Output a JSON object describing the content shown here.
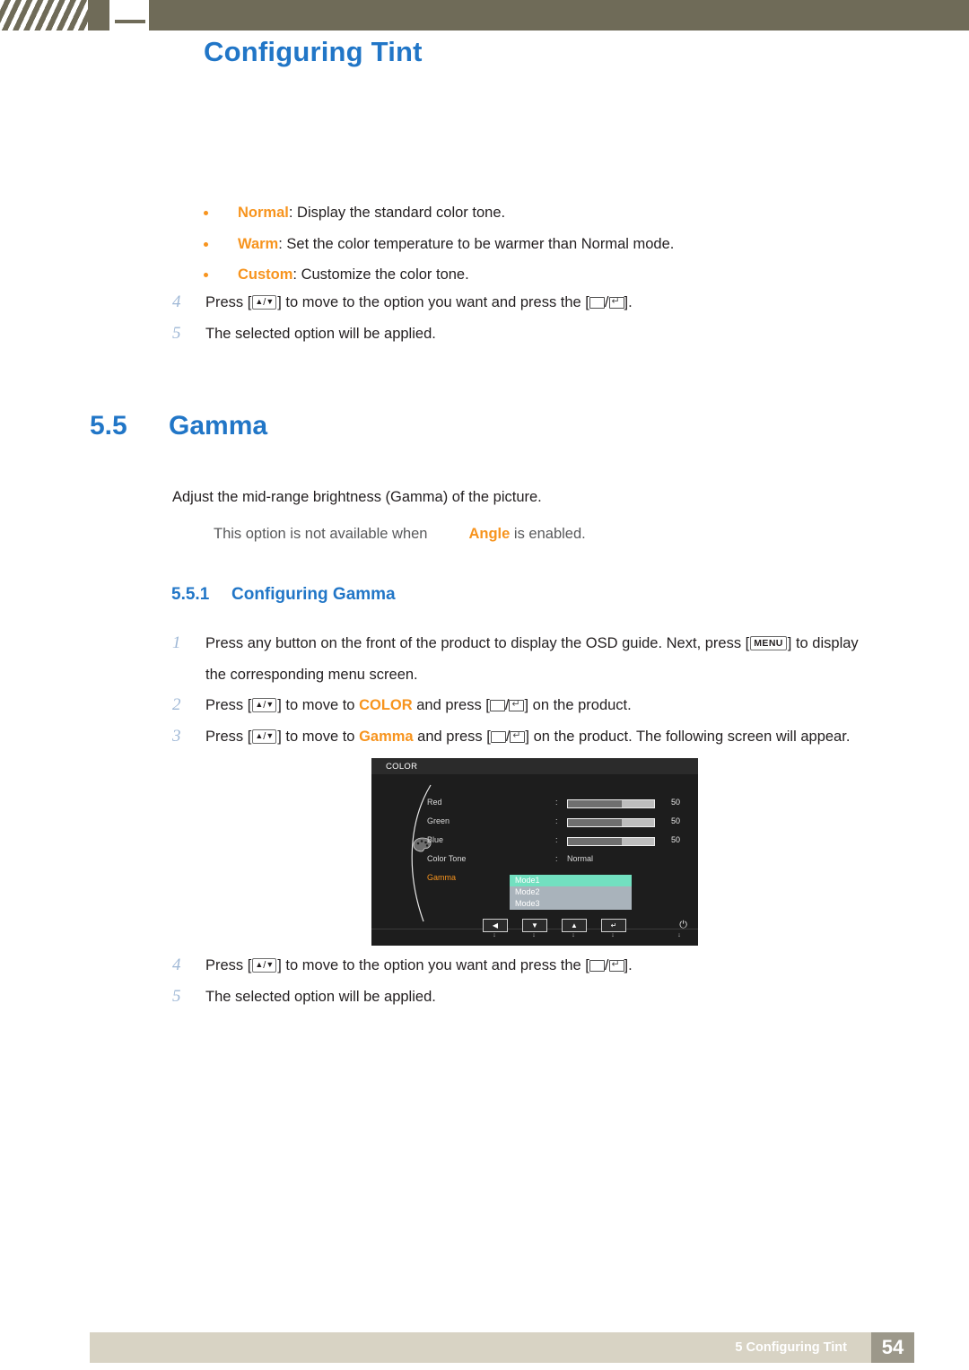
{
  "header": {
    "title": "Configuring Tint"
  },
  "bullets": [
    {
      "term": "Normal",
      "rest": ": Display the standard color tone."
    },
    {
      "term": "Warm",
      "rest": ": Set the color temperature to be warmer than Normal mode."
    },
    {
      "term": "Custom",
      "rest": ": Customize the color tone."
    }
  ],
  "steps_top": [
    {
      "num": "4",
      "pre": "Press [",
      "mid": "] to move to the option you want and press the [",
      "post": "]."
    },
    {
      "num": "5",
      "text": "The selected option will be applied."
    }
  ],
  "section": {
    "number": "5.5",
    "title": "Gamma",
    "paragraph": "Adjust the mid-range brightness (Gamma) of the picture.",
    "note_prefix": "This option is not available when",
    "note_keyword": "Angle",
    "note_suffix": "is enabled."
  },
  "subsection": {
    "number": "5.5.1",
    "title": "Configuring Gamma"
  },
  "steps": [
    {
      "num": "1",
      "text_a": "Press any button on the front of the product to display the OSD guide. Next, press [",
      "key": "MENU",
      "text_b": "] to display",
      "line2": "the corresponding menu screen."
    },
    {
      "num": "2",
      "text_a": "Press [",
      "text_b": "] to move to ",
      "keyword": "COLOR",
      "text_c": " and press [",
      "text_d": "] on the product."
    },
    {
      "num": "3",
      "text_a": "Press [",
      "text_b": "] to move to ",
      "keyword": "Gamma",
      "text_c": " and press [",
      "text_d": "] on the product. The following screen will appear."
    }
  ],
  "steps_bottom": [
    {
      "num": "4",
      "pre": "Press [",
      "mid": "] to move to the option you want and press the [",
      "post": "]."
    },
    {
      "num": "5",
      "text": "The selected option will be applied."
    }
  ],
  "osd": {
    "title": "COLOR",
    "rows": [
      {
        "label": "Red",
        "colon": ":",
        "value": "50",
        "fill": 62,
        "type": "bar"
      },
      {
        "label": "Green",
        "colon": ":",
        "value": "50",
        "fill": 62,
        "type": "bar"
      },
      {
        "label": "Blue",
        "colon": ":",
        "value": "50",
        "fill": 62,
        "type": "bar"
      },
      {
        "label": "Color Tone",
        "colon": ":",
        "value": "Normal",
        "type": "text"
      },
      {
        "label": "Gamma",
        "colon": ":",
        "value": "",
        "type": "dropdown"
      }
    ],
    "dropdown": {
      "items": [
        "Mode1",
        "Mode2",
        "Mode3"
      ],
      "selected_index": 0
    },
    "buttons": [
      {
        "glyph": "◀",
        "sub": "↓"
      },
      {
        "glyph": "▼",
        "sub": "↓"
      },
      {
        "glyph": "▲",
        "sub": "↓"
      },
      {
        "glyph": "↵",
        "sub": "↓"
      }
    ],
    "power_glyph": "⏻",
    "power_sub": "↓"
  },
  "footer": {
    "text": "5 Configuring Tint",
    "page": "54"
  },
  "colors": {
    "accent_blue": "#2176c7",
    "accent_orange": "#f7941e",
    "topbar": "#6f6b58",
    "footer_bar": "#d8d3c4",
    "footer_page": "#9c988a",
    "osd_select": "#72e0c0"
  }
}
